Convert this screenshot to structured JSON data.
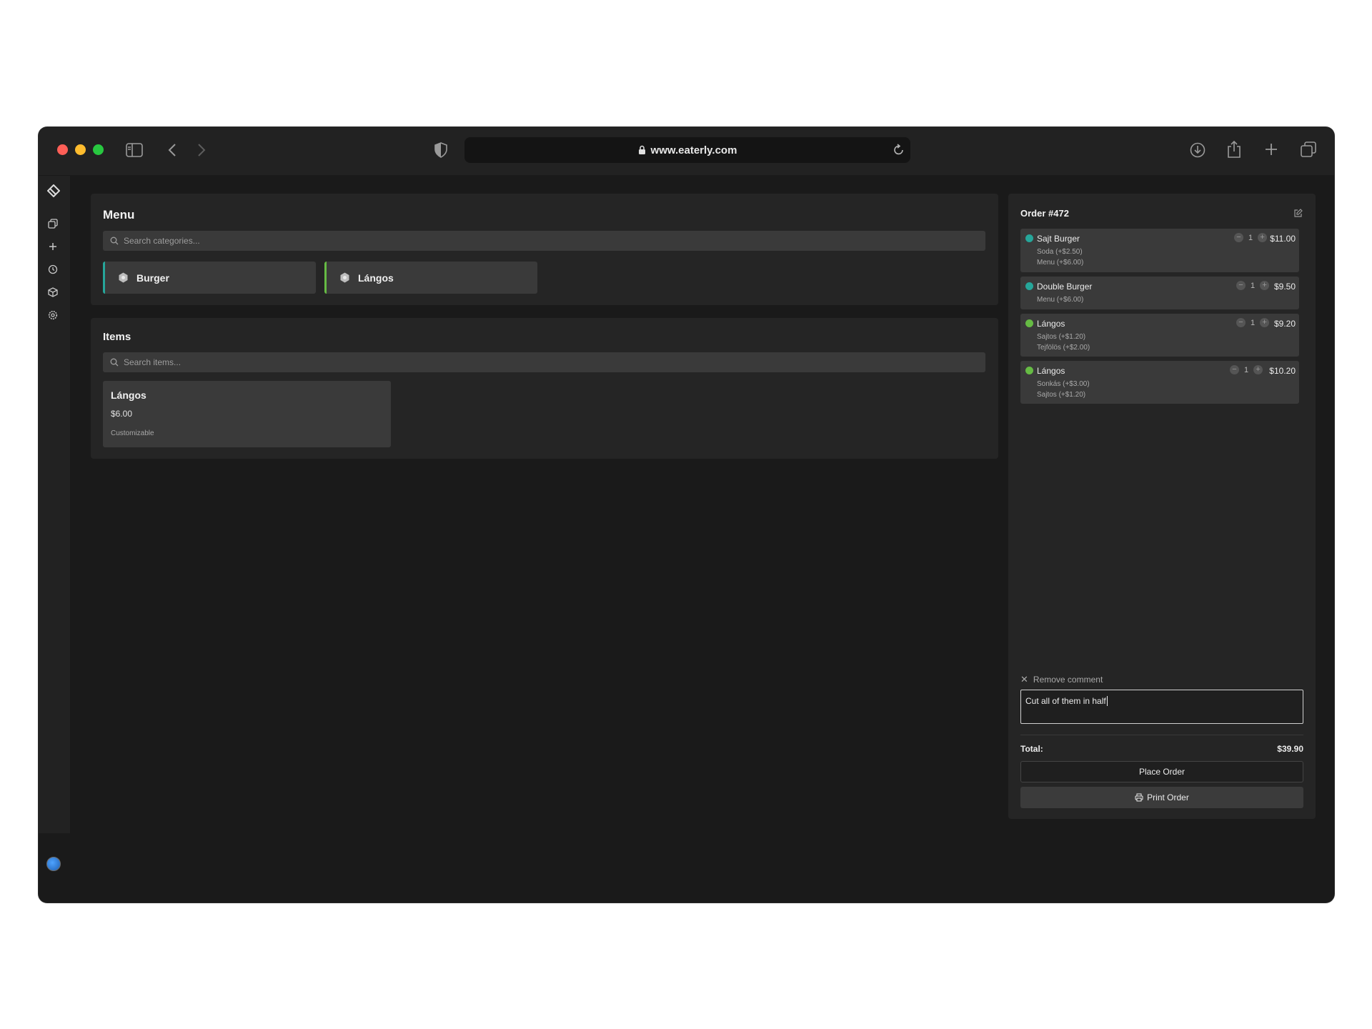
{
  "browser": {
    "url": "www.eaterly.com"
  },
  "menu": {
    "title": "Menu",
    "search_placeholder": "Search categories...",
    "categories": [
      {
        "label": "Burger",
        "accent": "#26a69a"
      },
      {
        "label": "Lángos",
        "accent": "#66bb44"
      }
    ]
  },
  "items": {
    "title": "Items",
    "search_placeholder": "Search items...",
    "cards": [
      {
        "name": "Lángos",
        "price": "$6.00",
        "note": "Customizable"
      }
    ]
  },
  "order": {
    "title": "Order #472",
    "lines": [
      {
        "name": "Sajt Burger",
        "qty": "1",
        "price": "$11.00",
        "color": "#26a69a",
        "options": [
          "Soda (+$2.50)",
          "Menu (+$6.00)"
        ]
      },
      {
        "name": "Double Burger",
        "qty": "1",
        "price": "$9.50",
        "color": "#26a69a",
        "options": [
          "Menu (+$6.00)"
        ]
      },
      {
        "name": "Lángos",
        "qty": "1",
        "price": "$9.20",
        "color": "#66bb44",
        "options": [
          "Sajtos (+$1.20)",
          "Tejfölös (+$2.00)"
        ]
      },
      {
        "name": "Lángos",
        "qty": "1",
        "price": "$10.20",
        "color": "#66bb44",
        "options": [
          "Sonkás (+$3.00)",
          "Sajtos (+$1.20)"
        ]
      }
    ],
    "remove_comment_label": "Remove comment",
    "comment": "Cut all of them in half",
    "total_label": "Total:",
    "total_value": "$39.90",
    "place_order_label": "Place Order",
    "print_order_label": "Print Order"
  }
}
